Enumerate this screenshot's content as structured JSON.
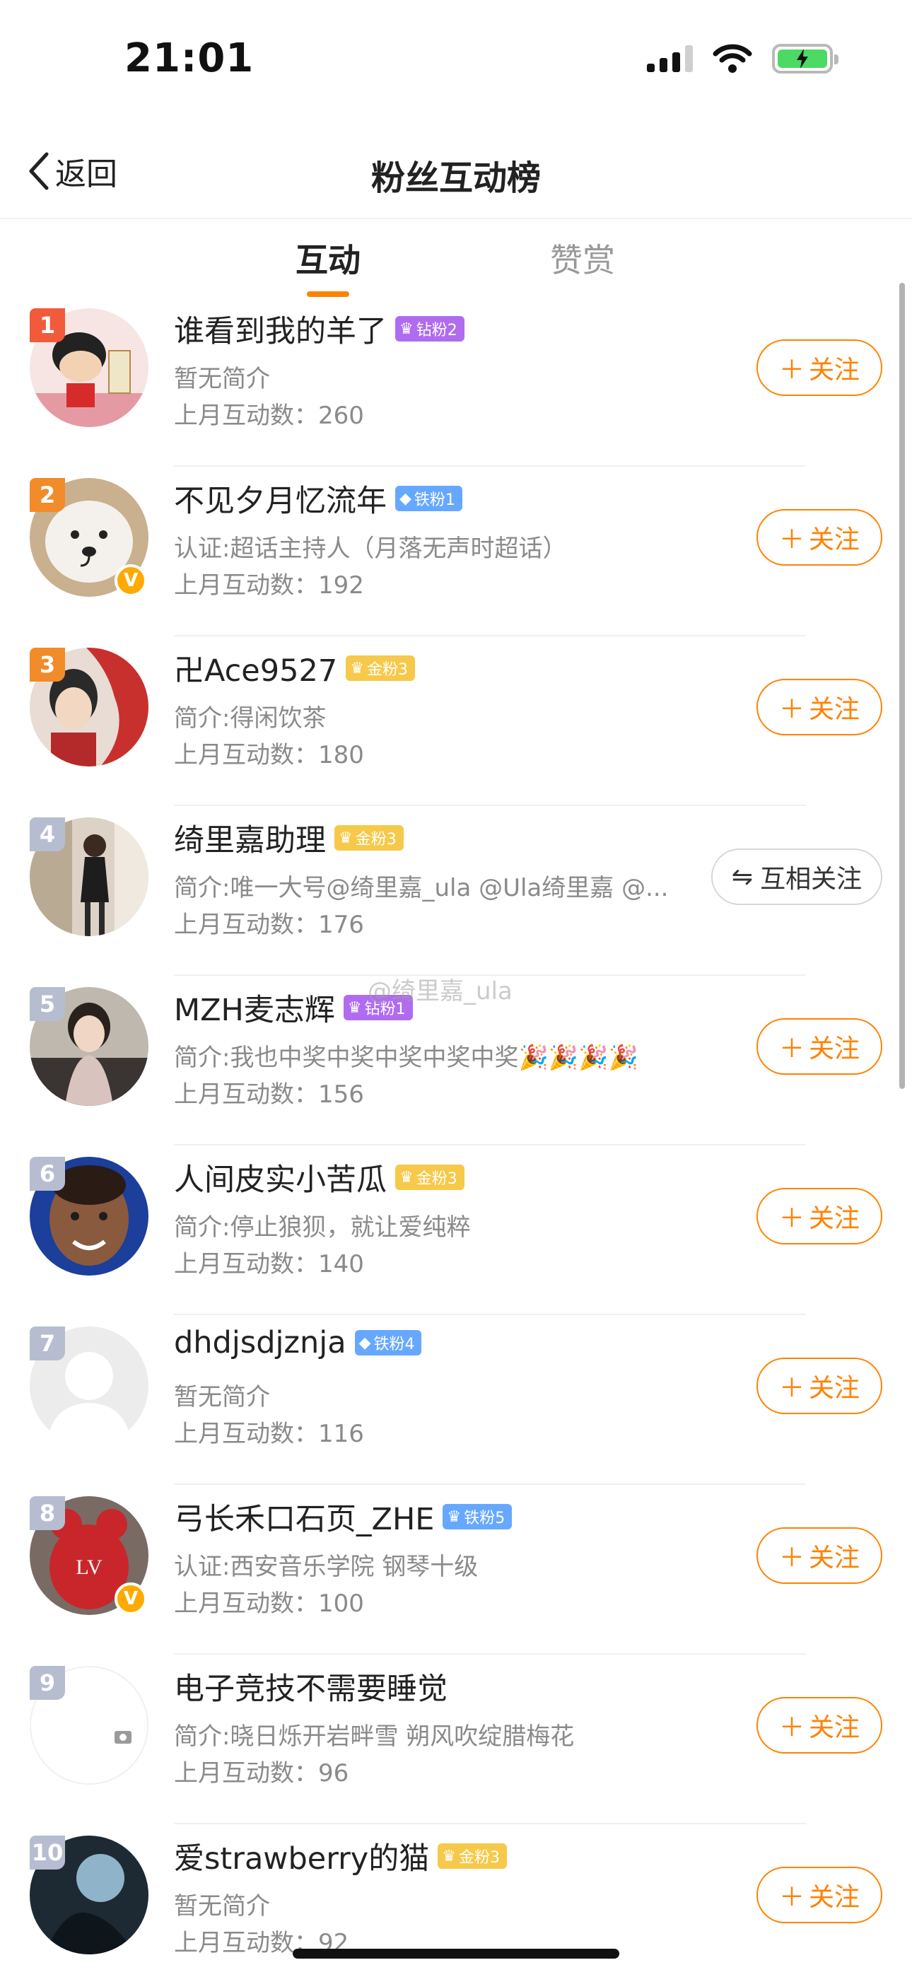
{
  "status_bar": {
    "time": "21:01"
  },
  "nav": {
    "back_label": "返回",
    "title": "粉丝互动榜"
  },
  "tabs": {
    "active": "互动",
    "inactive": "赞赏"
  },
  "follow_label": "关注",
  "mutual_label": "互相关注",
  "watermark": "@绮里嘉_ula",
  "users": [
    {
      "rank": "1",
      "name": "谁看到我的羊了",
      "badge": "钻粉2",
      "bio": "暂无简介",
      "count": "上月互动数：260",
      "follow": "关注"
    },
    {
      "rank": "2",
      "name": "不见夕月忆流年",
      "badge": "铁粉1",
      "bio": "认证:超话主持人（月落无声时超话）",
      "count": "上月互动数：192",
      "follow": "关注"
    },
    {
      "rank": "3",
      "name": "卍Ace9527",
      "badge": "金粉3",
      "bio": "简介:得闲饮茶",
      "count": "上月互动数：180",
      "follow": "关注"
    },
    {
      "rank": "4",
      "name": "绮里嘉助理",
      "badge": "金粉3",
      "bio": "简介:唯一大号@绮里嘉_ula @Ula绮里嘉 @...",
      "count": "上月互动数：176",
      "follow": "互相关注"
    },
    {
      "rank": "5",
      "name": "MZH麦志辉",
      "badge": "钻粉1",
      "bio": "简介:我也中奖中奖中奖中奖中奖🎉🎉🎉🎉",
      "count": "上月互动数：156",
      "follow": "关注"
    },
    {
      "rank": "6",
      "name": "人间皮实小苦瓜",
      "badge": "金粉3",
      "bio": "简介:停止狼狈，就让爱纯粹",
      "count": "上月互动数：140",
      "follow": "关注"
    },
    {
      "rank": "7",
      "name": "dhdjsdjznja",
      "badge": "铁粉4",
      "bio": "暂无简介",
      "count": "上月互动数：116",
      "follow": "关注"
    },
    {
      "rank": "8",
      "name": "弓长禾口石页_ZHE",
      "badge": "铁粉5",
      "bio": "认证:西安音乐学院 钢琴十级",
      "count": "上月互动数：100",
      "follow": "关注"
    },
    {
      "rank": "9",
      "name": "电子竞技不需要睡觉",
      "badge": "",
      "bio": "简介:晓日烁开岩畔雪 朔风吹绽腊梅花",
      "count": "上月互动数：96",
      "follow": "关注"
    },
    {
      "rank": "10",
      "name": "爱strawberry的猫",
      "badge": "金粉3",
      "bio": "暂无简介",
      "count": "上月互动数：92",
      "follow": "关注"
    }
  ],
  "colors": {
    "accent": "#ff8200",
    "rank_top": "#f15a3a",
    "rank_top3": "#f28b2a",
    "rank_other": "#b6bdd0",
    "diamond_badge": "#b06cf0",
    "iron_badge": "#66a8ff",
    "gold_badge": "#f6c94a"
  }
}
